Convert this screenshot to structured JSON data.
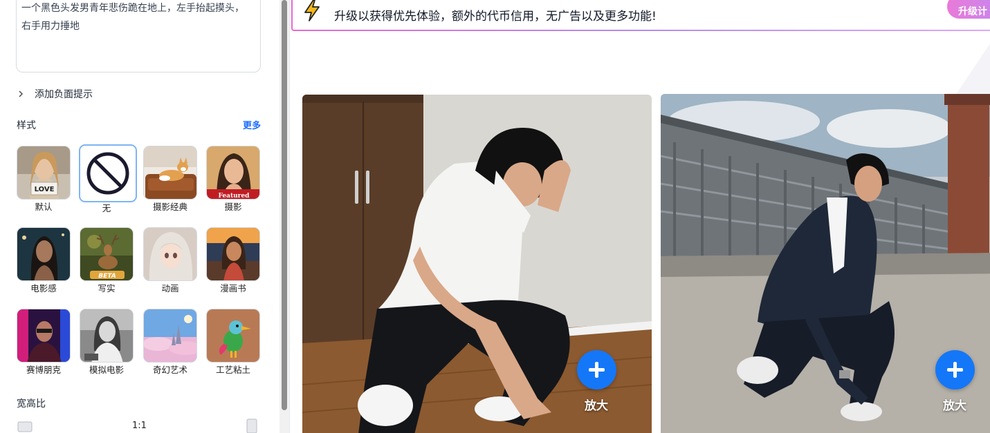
{
  "prompt": {
    "text": "一个黑色头发男青年悲伤跪在地上，左手抬起摸头，右手用力捶地"
  },
  "negative_prompt": {
    "label": "添加负面提示"
  },
  "styles": {
    "title": "样式",
    "more_label": "更多",
    "items": [
      {
        "label": "默认",
        "thumb_text": "LOVE",
        "icon": "portrait-girl-thumb"
      },
      {
        "label": "无",
        "icon": "no-symbol-icon",
        "selected": true
      },
      {
        "label": "摄影经典",
        "icon": "dog-sofa-thumb"
      },
      {
        "label": "摄影",
        "thumb_text": "Featured",
        "icon": "woman-portrait-thumb"
      },
      {
        "label": "电影感",
        "icon": "cinematic-woman-thumb"
      },
      {
        "label": "写实",
        "thumb_text": "BETA",
        "icon": "deer-thumb"
      },
      {
        "label": "动画",
        "icon": "anime-girl-thumb"
      },
      {
        "label": "漫画书",
        "icon": "comic-woman-thumb"
      },
      {
        "label": "赛博朋克",
        "icon": "cyberpunk-man-thumb"
      },
      {
        "label": "模拟电影",
        "icon": "bw-woman-thumb"
      },
      {
        "label": "奇幻艺术",
        "icon": "fantasy-castle-thumb"
      },
      {
        "label": "工艺粘土",
        "icon": "clay-bird-thumb"
      }
    ]
  },
  "aspect": {
    "title": "宽高比",
    "value": "1:1"
  },
  "banner": {
    "text": "升级以获得优先体验，额外的代币信用，无广告以及更多功能!",
    "button_label": "升级计",
    "colors": {
      "border_start": "#e56ad0",
      "border_end": "#e0a9f6"
    }
  },
  "results": [
    {
      "zoom_label": "放大",
      "description": "white-shirt-kneeling-man"
    },
    {
      "zoom_label": "放大",
      "description": "suit-kneeling-man"
    }
  ],
  "colors": {
    "accent": "#1477f8",
    "link": "#1a6dff"
  }
}
